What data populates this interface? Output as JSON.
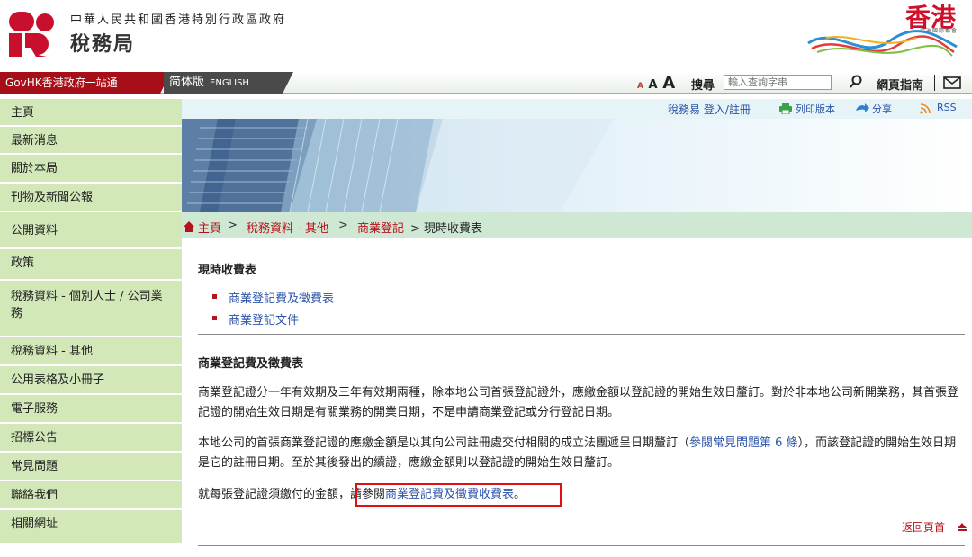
{
  "header": {
    "department_full": "中華人民共和國香港特別行政區政府",
    "department_name": "稅務局",
    "brand_logo_text": "香港",
    "brand_logo_sub": "亞洲國際都會"
  },
  "topbar": {
    "govhk": "GovHK香港政府一站通",
    "lang_simplified": "简体版",
    "lang_english": "ENGLISH",
    "font_small": "A",
    "font_medium": "A",
    "font_large": "A",
    "search_label": "搜尋",
    "search_placeholder": "輸入查詢字串",
    "site_guide": "網頁指南"
  },
  "sidebar": {
    "items": [
      {
        "label": "主頁"
      },
      {
        "label": "最新消息"
      },
      {
        "label": "關於本局"
      },
      {
        "label": "刊物及新聞公報"
      },
      {
        "label": "公開資料"
      },
      {
        "label": "政策"
      },
      {
        "label": "稅務資料 - 個別人士 / 公司業務"
      },
      {
        "label": "稅務資料 - 其他"
      },
      {
        "label": "公用表格及小冊子"
      },
      {
        "label": "電子服務"
      },
      {
        "label": "招標公告"
      },
      {
        "label": "常見問題"
      },
      {
        "label": "聯絡我們"
      },
      {
        "label": "相關網址"
      }
    ]
  },
  "utility": {
    "etax": "稅務易 登入/註冊",
    "print": "列印版本",
    "share": "分享",
    "rss": "RSS"
  },
  "breadcrumb": {
    "home": "主頁",
    "sep": ">",
    "level2": "稅務資料 - 其他",
    "level3": "商業登記",
    "current": "> 現時收費表"
  },
  "content": {
    "title": "現時收費表",
    "links": [
      "商業登記費及徵費表",
      "商業登記文件"
    ],
    "section_title": "商業登記費及徵費表",
    "para1": "商業登記證分一年有效期及三年有效期兩種，除本地公司首張登記證外，應繳金額以登記證的開始生效日釐訂。對於非本地公司新開業務，其首張登記證的開始生效日期是有關業務的開業日期，不是申請商業登記或分行登記日期。",
    "para2_a": "本地公司的首張商業登記證的應繳金額是以其向公司註冊處交付相關的成立法團遞呈日期釐訂（",
    "para2_link": "參閱常見問題第 6 條",
    "para2_b": "），而該登記證的開始生效日期是它的註冊日期。至於其後發出的續證，應繳金額則以登記證的開始生效日釐訂。",
    "para3_a": "就每張登記證須繳付的金額，",
    "para3_b": "請參閱",
    "para3_link": "商業登記費及徵費收費表",
    "para3_c": "。",
    "back_to_top": "返回頁首"
  },
  "colors": {
    "brand_red": "#b6121b",
    "sidebar_green": "#d2e8b8",
    "link_blue": "#2b54a8",
    "highlight_red": "#e01010"
  }
}
